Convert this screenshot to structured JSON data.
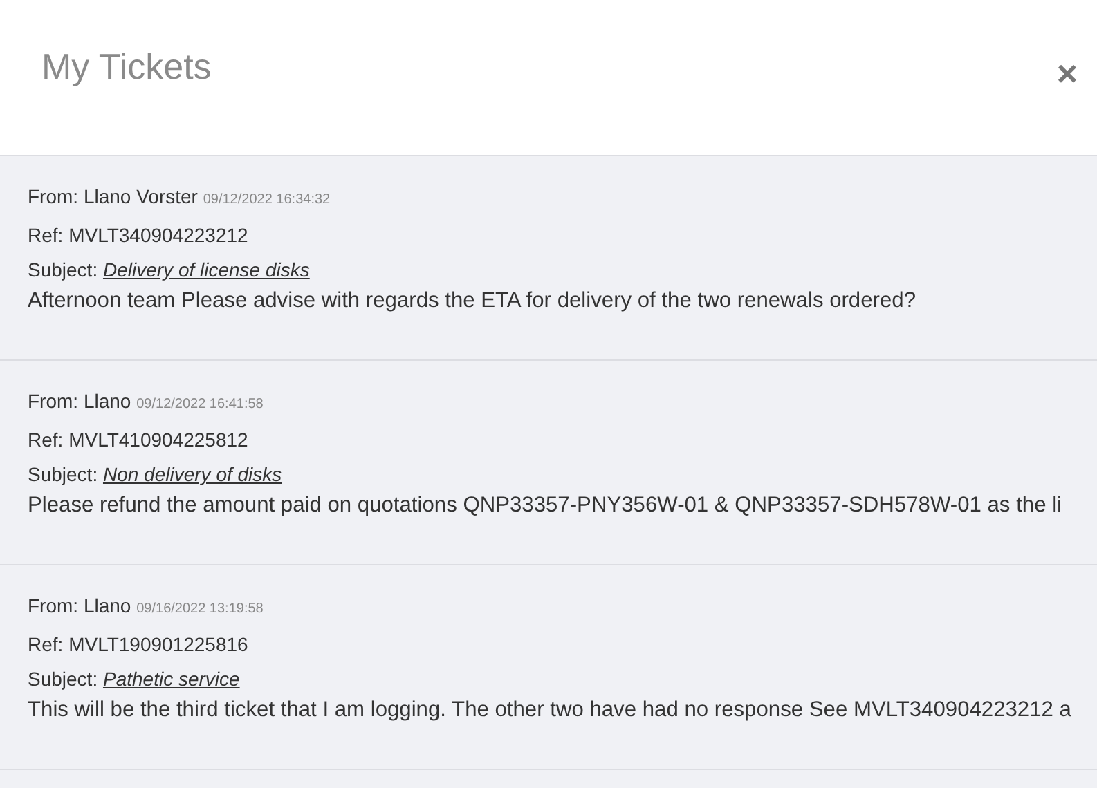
{
  "header": {
    "title": "My Tickets",
    "close": "×"
  },
  "tickets": [
    {
      "from_label": "From:",
      "from": "Llano Vorster",
      "date": "09/12/2022 16:34:32",
      "ref_label": "Ref:",
      "ref": "MVLT340904223212",
      "subject_label": "Subject:",
      "subject": "Delivery of license disks",
      "message": "Afternoon team Please advise with regards the ETA for delivery of the two renewals ordered?"
    },
    {
      "from_label": "From:",
      "from": "Llano",
      "date": "09/12/2022 16:41:58",
      "ref_label": "Ref:",
      "ref": "MVLT410904225812",
      "subject_label": "Subject:",
      "subject": "Non delivery of disks",
      "message": "Please refund the amount paid on quotations QNP33357-PNY356W-01 & QNP33357-SDH578W-01 as the li"
    },
    {
      "from_label": "From:",
      "from": "Llano",
      "date": "09/16/2022 13:19:58",
      "ref_label": "Ref:",
      "ref": "MVLT190901225816",
      "subject_label": "Subject:",
      "subject": "Pathetic service",
      "message": "This will be the third ticket that I am logging. The other two have had no response See MVLT340904223212 a"
    }
  ]
}
